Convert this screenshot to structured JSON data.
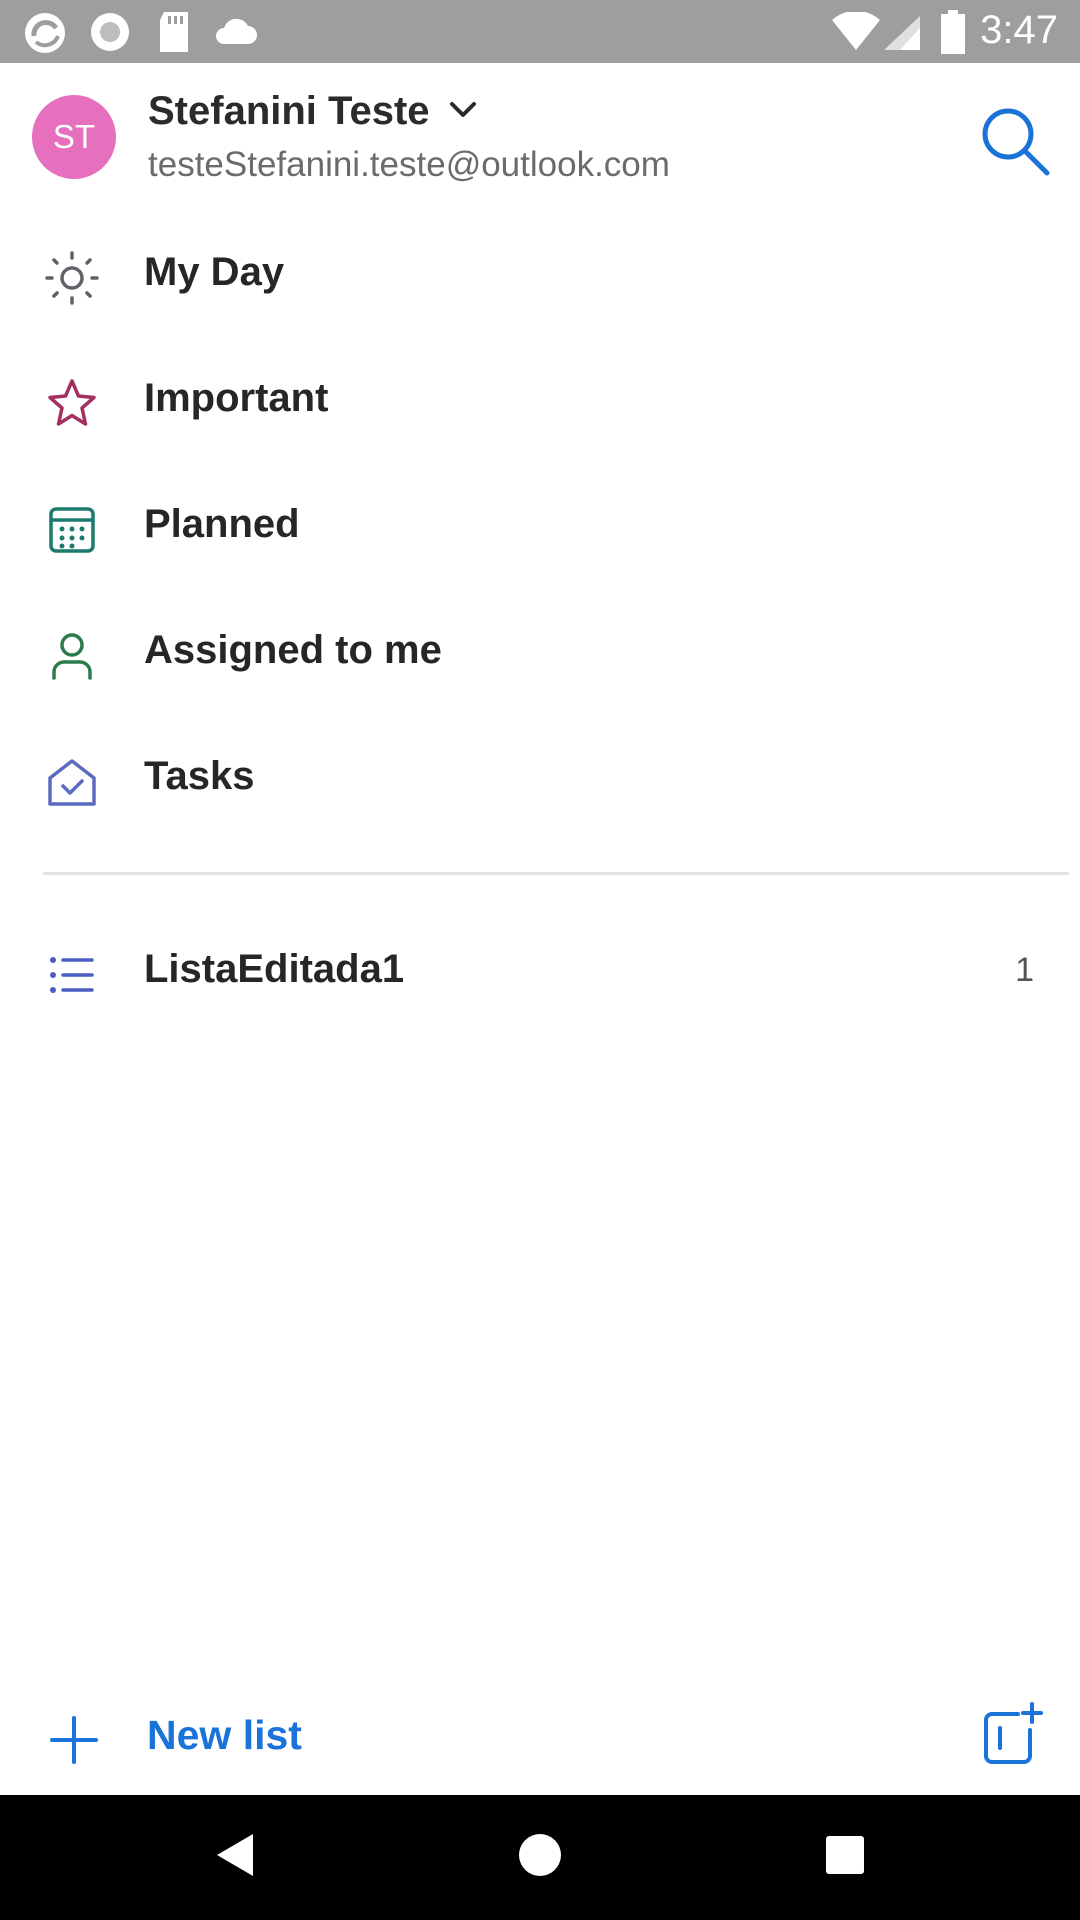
{
  "status_bar": {
    "time": "3:47",
    "left_icons": [
      "app-logo-icon",
      "record-icon",
      "sd-card-icon",
      "cloud-icon"
    ],
    "right_icons": [
      "wifi-icon",
      "cellular-signal-icon",
      "battery-icon"
    ]
  },
  "account": {
    "initials": "ST",
    "name": "Stefanini Teste",
    "email": "testeStefanini.teste@outlook.com",
    "avatar_color": "#e670bd"
  },
  "nav": {
    "items": [
      {
        "label": "My Day",
        "icon": "sun-icon",
        "color": "#5f6368"
      },
      {
        "label": "Important",
        "icon": "star-icon",
        "color": "#a4305f"
      },
      {
        "label": "Planned",
        "icon": "calendar-icon",
        "color": "#1b7a6e"
      },
      {
        "label": "Assigned to me",
        "icon": "person-icon",
        "color": "#2e7a4f"
      },
      {
        "label": "Tasks",
        "icon": "home-check-icon",
        "color": "#5c6bc0"
      }
    ]
  },
  "lists": [
    {
      "label": "ListaEditada1",
      "count": "1",
      "icon": "list-icon",
      "color": "#4a5ec6"
    }
  ],
  "footer": {
    "new_list_label": "New list",
    "accent": "#1a73d9"
  }
}
